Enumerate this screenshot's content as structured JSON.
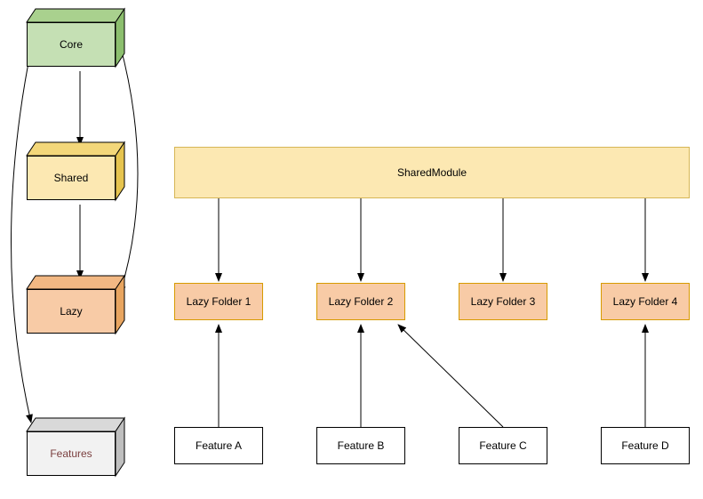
{
  "cubes": {
    "core": {
      "label": "Core"
    },
    "shared": {
      "label": "Shared"
    },
    "lazy": {
      "label": "Lazy"
    },
    "features": {
      "label": "Features"
    }
  },
  "sharedModule": {
    "label": "SharedModule"
  },
  "lazyFolders": [
    {
      "label": "Lazy Folder 1"
    },
    {
      "label": "Lazy Folder 2"
    },
    {
      "label": "Lazy Folder 3"
    },
    {
      "label": "Lazy Folder 4"
    }
  ],
  "features": [
    {
      "label": "Feature A"
    },
    {
      "label": "Feature B"
    },
    {
      "label": "Feature C"
    },
    {
      "label": "Feature D"
    }
  ],
  "arrows": [
    {
      "from": "shared-module",
      "to": "lazy-folder-1"
    },
    {
      "from": "shared-module",
      "to": "lazy-folder-2"
    },
    {
      "from": "shared-module",
      "to": "lazy-folder-3"
    },
    {
      "from": "shared-module",
      "to": "lazy-folder-4"
    },
    {
      "from": "feature-a",
      "to": "lazy-folder-1"
    },
    {
      "from": "feature-b",
      "to": "lazy-folder-2"
    },
    {
      "from": "feature-c",
      "to": "lazy-folder-2"
    },
    {
      "from": "feature-d",
      "to": "lazy-folder-4"
    },
    {
      "from": "cube-core",
      "to": "cube-shared"
    },
    {
      "from": "cube-core",
      "to": "cube-lazy",
      "curve": "right"
    },
    {
      "from": "cube-core",
      "to": "cube-features",
      "curve": "left"
    },
    {
      "from": "cube-shared",
      "to": "cube-lazy"
    }
  ]
}
